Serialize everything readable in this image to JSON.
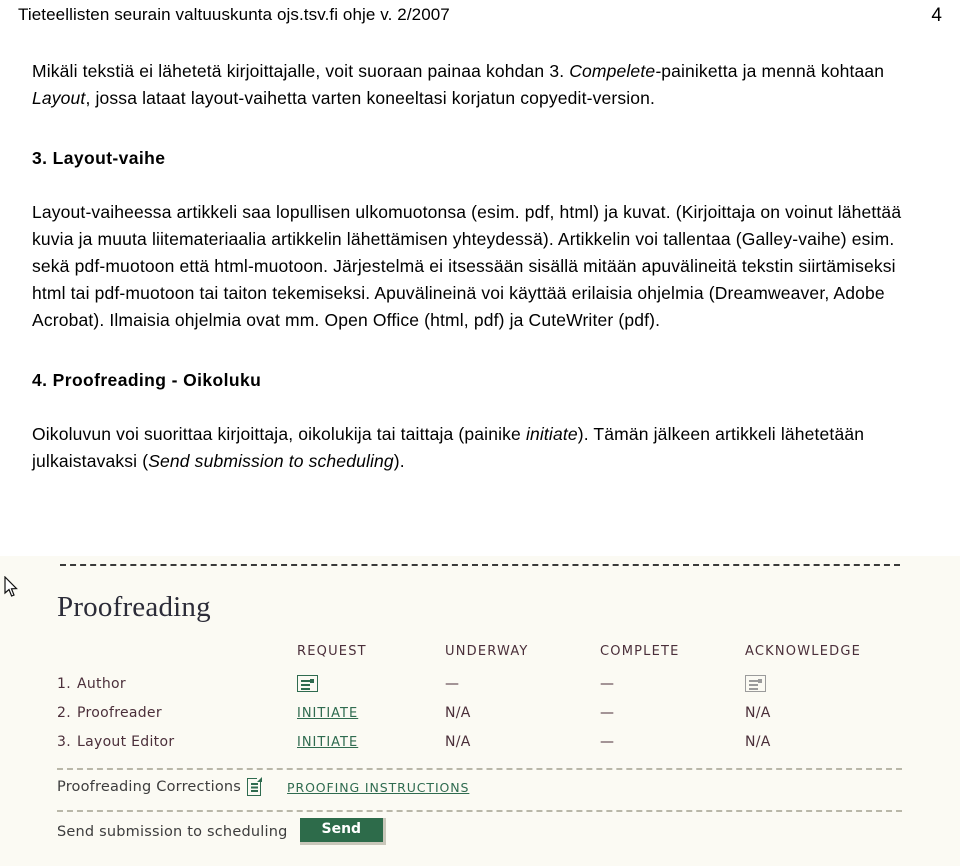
{
  "header": {
    "doc_title": "Tieteellisten seurain valtuuskunta ojs.tsv.fi ohje v. 2/2007",
    "page_number": "4"
  },
  "document": {
    "intro_p1_a": "Mikäli tekstiä ei lähetetä kirjoittajalle, voit suoraan painaa kohdan 3. ",
    "intro_p1_em1": "Compelete-",
    "intro_p1_b": "painiketta ja mennä kohtaan ",
    "intro_p1_em2": "Layout",
    "intro_p1_c": ", jossa lataat layout-vaihetta varten koneeltasi korjatun copyedit-version.",
    "section3_title": "3. Layout-vaihe",
    "section3_body": "Layout-vaiheessa artikkeli saa lopullisen ulkomuotonsa (esim. pdf, html) ja kuvat. (Kirjoittaja on voinut lähettää kuvia ja muuta liitemateriaalia artikkelin lähettämisen yhteydessä). Artikkelin voi tallentaa (Galley-vaihe) esim. sekä pdf-muotoon että html-muotoon. Järjestelmä ei itsessään sisällä mitään apuvälineitä tekstin siirtämiseksi html tai pdf-muotoon tai taiton tekemiseksi. Apuvälineinä voi käyttää erilaisia ohjelmia (Dreamweaver, Adobe Acrobat). Ilmaisia ohjelmia ovat mm. Open Office (html, pdf) ja CuteWriter (pdf).",
    "section4_title": "4. Proofreading - Oikoluku",
    "section4_a": "Oikoluvun voi suorittaa kirjoittaja, oikolukija tai taittaja (painike ",
    "section4_em1": "initiate",
    "section4_b": "). Tämän jälkeen artikkeli lähetetään julkaistavaksi (",
    "section4_em2": "Send submission to scheduling",
    "section4_c": ")."
  },
  "screenshot": {
    "title": "Proofreading",
    "columns": {
      "role": "",
      "request": "REQUEST",
      "underway": "UNDERWAY",
      "complete": "COMPLETE",
      "acknowledge": "ACKNOWLEDGE"
    },
    "rows": [
      {
        "number": "1.",
        "role": "Author",
        "request_type": "icon-enabled",
        "request": "",
        "underway": "—",
        "complete": "—",
        "acknowledge_type": "icon-disabled",
        "acknowledge": ""
      },
      {
        "number": "2.",
        "role": "Proofreader",
        "request_type": "link",
        "request": "INITIATE",
        "underway": "N/A",
        "complete": "—",
        "acknowledge_type": "text",
        "acknowledge": "N/A"
      },
      {
        "number": "3.",
        "role": "Layout Editor",
        "request_type": "link",
        "request": "INITIATE",
        "underway": "N/A",
        "complete": "—",
        "acknowledge_type": "text",
        "acknowledge": "N/A"
      }
    ],
    "corrections_label": "Proofreading Corrections",
    "proofing_instructions_link": "PROOFING INSTRUCTIONS",
    "send_label": "Send submission to scheduling",
    "send_button": "Send",
    "colors": {
      "background": "#fbfaf3",
      "link_green": "#2f6b4f",
      "button_green": "#2d6b4a",
      "text_maroon": "#4b2f3a"
    }
  }
}
